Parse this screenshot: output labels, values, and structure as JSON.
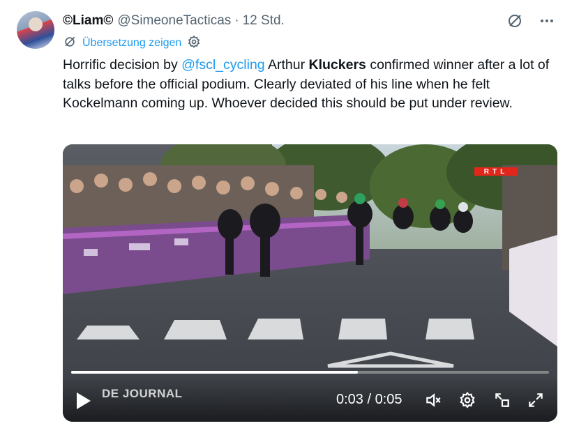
{
  "tweet": {
    "display_name": "Liam",
    "handle": "@SimeoneTacticas",
    "separator": "·",
    "timestamp": "12 Std.",
    "translate_label": "Übersetzung zeigen",
    "text": {
      "part1": "Horrific decision by ",
      "mention": "@fscl_cycling",
      "part2": " Arthur ",
      "bold_name": "Kluckers",
      "part3": " confirmed winner after a lot of talks before the official podium. Clearly deviated of his line when he felt Kockelmann coming up. Whoever decided this should be put under review."
    }
  },
  "video": {
    "broadcaster_logo": "RTL",
    "watermark": "DE JOURNAL",
    "current_time": "0:03",
    "time_separator": "/",
    "duration": "0:05",
    "progress_fraction": 0.6,
    "icons": [
      "play-icon",
      "volume-icon",
      "settings-icon",
      "pip-icon",
      "fullscreen-icon"
    ]
  },
  "colors": {
    "accent": "#1d9bf0",
    "text": "#0f1419",
    "muted": "#536471"
  }
}
